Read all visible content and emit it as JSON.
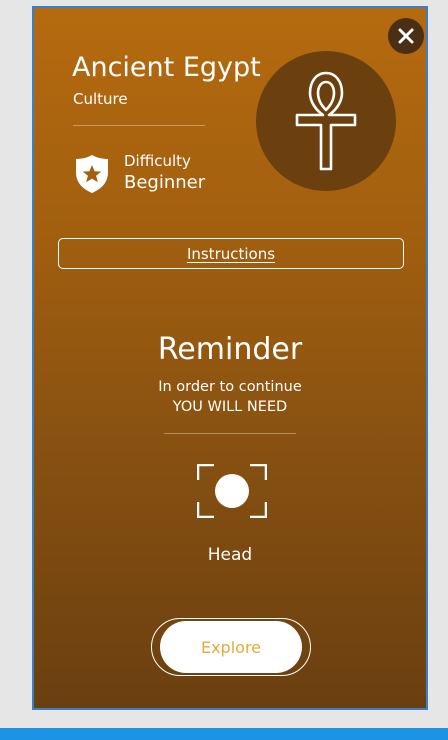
{
  "topic": {
    "title": "Ancient Egypt",
    "category": "Culture",
    "emblem_icon": "ankh-icon"
  },
  "difficulty": {
    "label": "Difficulty",
    "value": "Beginner",
    "icon": "badge-star-icon"
  },
  "instructions": {
    "label": "Instructions"
  },
  "reminder": {
    "title": "Reminder",
    "line1": "In order to continue",
    "line2": "YOU WILL NEED",
    "requirement_icon": "face-scan-icon",
    "requirement_label": "Head"
  },
  "actions": {
    "explore_label": "Explore",
    "close_icon": "close-icon"
  },
  "colors": {
    "card_top": "#b56a0f",
    "card_bottom": "#6a3f10",
    "emblem_bg": "#6b3f0e",
    "explore_text": "#e2ad37",
    "bottom_bar": "#1d93e6",
    "card_border": "#3b7fc4"
  }
}
